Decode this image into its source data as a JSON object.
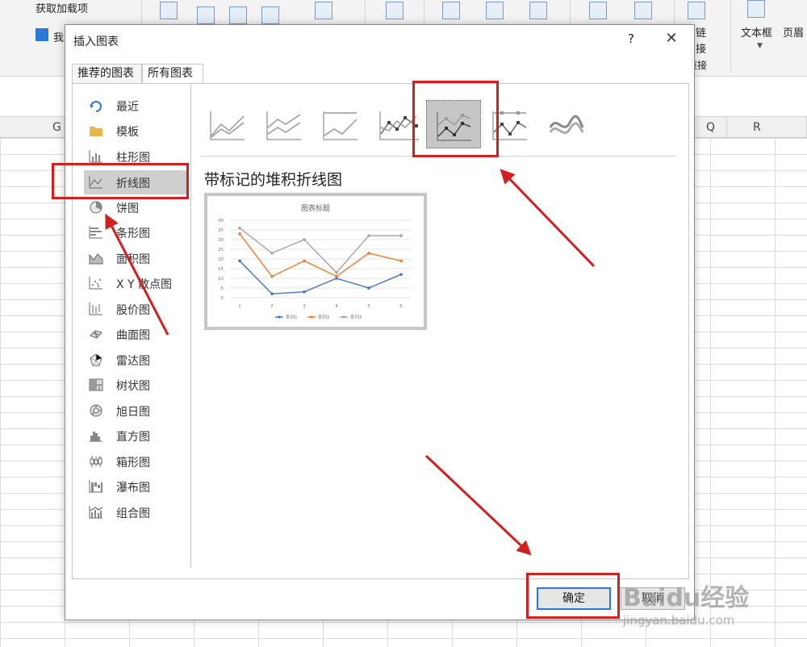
{
  "excel": {
    "ribbon_get_addins": "获取加载项",
    "ribbon_my": "我",
    "ribbon_link": "链",
    "ribbon_link2": "接",
    "ribbon_link3": "链接",
    "ribbon_textbox": "文本框",
    "ribbon_header": "页眉",
    "col_g": "G",
    "col_q": "Q",
    "col_r": "R"
  },
  "dialog": {
    "title": "插入图表",
    "help": "?",
    "close": "✕",
    "tabs": [
      {
        "label": "推荐的图表"
      },
      {
        "label": "所有图表"
      }
    ],
    "chart_types": [
      {
        "label": "最近",
        "icon": "recent-icon"
      },
      {
        "label": "模板",
        "icon": "folder-icon"
      },
      {
        "label": "柱形图",
        "icon": "column-chart-icon"
      },
      {
        "label": "折线图",
        "icon": "line-chart-icon",
        "selected": true
      },
      {
        "label": "饼图",
        "icon": "pie-chart-icon"
      },
      {
        "label": "条形图",
        "icon": "bar-chart-icon"
      },
      {
        "label": "面积图",
        "icon": "area-chart-icon"
      },
      {
        "label": "X Y 散点图",
        "icon": "scatter-chart-icon"
      },
      {
        "label": "股价图",
        "icon": "stock-chart-icon"
      },
      {
        "label": "曲面图",
        "icon": "surface-chart-icon"
      },
      {
        "label": "雷达图",
        "icon": "radar-chart-icon"
      },
      {
        "label": "树状图",
        "icon": "treemap-chart-icon"
      },
      {
        "label": "旭日图",
        "icon": "sunburst-chart-icon"
      },
      {
        "label": "直方图",
        "icon": "histogram-chart-icon"
      },
      {
        "label": "箱形图",
        "icon": "box-chart-icon"
      },
      {
        "label": "瀑布图",
        "icon": "waterfall-chart-icon"
      },
      {
        "label": "组合图",
        "icon": "combo-chart-icon"
      }
    ],
    "selected_subtype_index": 4,
    "subtype_title": "带标记的堆积折线图",
    "ok_label": "确定",
    "cancel_label": "取消"
  },
  "chart_data": {
    "type": "line",
    "title": "图表标题",
    "categories": [
      "1",
      "2",
      "3",
      "4",
      "5",
      "6"
    ],
    "ylim": [
      0,
      40
    ],
    "yticks": [
      "0",
      "5",
      "10",
      "15",
      "20",
      "25",
      "30",
      "35",
      "40"
    ],
    "series": [
      {
        "name": "系列1",
        "values": [
          19,
          2,
          3,
          10,
          5,
          12
        ],
        "color": "#4472c4"
      },
      {
        "name": "系列2",
        "values": [
          33,
          11,
          19,
          11,
          23,
          19
        ],
        "color": "#ed7d31"
      },
      {
        "name": "系列3",
        "values": [
          36,
          23,
          30,
          13,
          32,
          32
        ],
        "color": "#a5a5a5"
      }
    ],
    "legend": "bottom",
    "grid": true
  },
  "watermark": {
    "brand": "Baidu经验",
    "site": "jingyan.baidu.com"
  },
  "annotation_color": "#d21f1f"
}
